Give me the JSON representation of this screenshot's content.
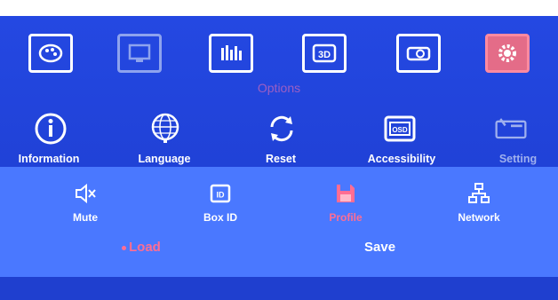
{
  "menu": {
    "title": "Options",
    "top_icons": [
      {
        "name": "picture-palette-icon",
        "state": "normal"
      },
      {
        "name": "monitor-icon",
        "state": "dim"
      },
      {
        "name": "equalizer-icon",
        "state": "normal"
      },
      {
        "name": "3d-icon",
        "state": "normal"
      },
      {
        "name": "projector-icon",
        "state": "normal"
      },
      {
        "name": "gear-icon",
        "state": "active"
      }
    ],
    "options": [
      {
        "label": "Information",
        "icon": "info-icon"
      },
      {
        "label": "Language",
        "icon": "globe-icon"
      },
      {
        "label": "Reset",
        "icon": "reset-icon"
      },
      {
        "label": "Accessibility",
        "icon": "osd-icon"
      },
      {
        "label": "Setting",
        "icon": "setting-tools-icon"
      }
    ],
    "settings": [
      {
        "label": "Mute",
        "icon": "mute-icon"
      },
      {
        "label": "Box ID",
        "icon": "id-icon"
      },
      {
        "label": "Profile",
        "icon": "floppy-disk-icon"
      },
      {
        "label": "Network",
        "icon": "network-icon"
      }
    ],
    "profile_actions": {
      "load": "Load",
      "save": "Save"
    },
    "osd_icon_text": "OSD",
    "id_icon_text": "ID"
  },
  "colors": {
    "background": "#1f3fcf",
    "panel": "#4a78ff",
    "active": "#ff6d93",
    "dim": "#9fb0ee"
  }
}
